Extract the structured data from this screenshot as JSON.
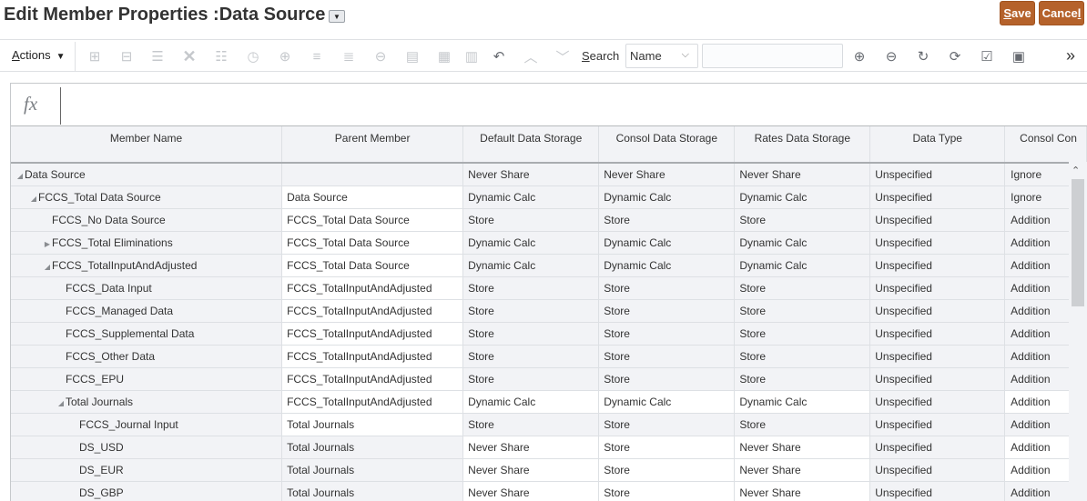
{
  "header": {
    "title": "Edit Member Properties :Data Source",
    "title_menu_icon": "dropdown-caret",
    "save_label": "Save",
    "save_mnemonic": "S",
    "cancel_label": "Cancel",
    "cancel_mnemonic": "l"
  },
  "toolbar": {
    "actions_label": "Actions",
    "actions_caret": "▼",
    "icons": [
      {
        "name": "add-child-icon",
        "enabled": false
      },
      {
        "name": "add-sibling-icon",
        "enabled": false
      },
      {
        "name": "edit-member-icon",
        "enabled": false
      },
      {
        "name": "delete-icon",
        "enabled": false
      },
      {
        "name": "expand-tree-icon",
        "enabled": false
      },
      {
        "name": "history-icon",
        "enabled": false
      },
      {
        "name": "zoom-in-icon",
        "enabled": false
      },
      {
        "name": "move-up-icon",
        "enabled": false
      },
      {
        "name": "move-down-icon",
        "enabled": false
      },
      {
        "name": "zoom-out-icon",
        "enabled": false
      },
      {
        "name": "cut-icon",
        "enabled": false
      },
      {
        "name": "remove-icon",
        "enabled": false
      },
      {
        "name": "columns-icon",
        "enabled": false
      },
      {
        "name": "undo-icon",
        "enabled": true
      },
      {
        "name": "previous-icon",
        "enabled": false
      },
      {
        "name": "next-icon",
        "enabled": false
      }
    ],
    "search_label": "Search",
    "search_mnemonic": "S",
    "search_by": "Name",
    "search_value": "",
    "right_icons": [
      {
        "name": "zoom-in-ancestors-icon"
      },
      {
        "name": "zoom-out-descendants-icon"
      },
      {
        "name": "refresh-icon"
      },
      {
        "name": "sync-icon"
      },
      {
        "name": "validate-icon"
      },
      {
        "name": "review-icon"
      }
    ],
    "overflow_label": "»"
  },
  "formula_bar": {
    "fx_label": "fx",
    "value": ""
  },
  "grid": {
    "columns": [
      "Member Name",
      "Parent Member",
      "Default Data Storage",
      "Consol Data Storage",
      "Rates Data Storage",
      "Data Type",
      "Consol Con"
    ],
    "rows": [
      {
        "name": "Data Source",
        "level": 0,
        "toggle": "expanded",
        "parent": "",
        "default_storage": "Never Share",
        "consol_storage": "Never Share",
        "rates_storage": "Never Share",
        "data_type": "Unspecified",
        "consol_op": "Ignore"
      },
      {
        "name": "FCCS_Total Data Source",
        "level": 1,
        "toggle": "expanded",
        "parent": "Data Source",
        "default_storage": "Dynamic Calc",
        "consol_storage": "Dynamic Calc",
        "rates_storage": "Dynamic Calc",
        "data_type": "Unspecified",
        "consol_op": "Ignore"
      },
      {
        "name": "FCCS_No Data Source",
        "level": 2,
        "toggle": "none",
        "parent": "FCCS_Total Data Source",
        "default_storage": "Store",
        "consol_storage": "Store",
        "rates_storage": "Store",
        "data_type": "Unspecified",
        "consol_op": "Addition"
      },
      {
        "name": "FCCS_Total Eliminations",
        "level": 2,
        "toggle": "collapsed",
        "parent": "FCCS_Total Data Source",
        "default_storage": "Dynamic Calc",
        "consol_storage": "Dynamic Calc",
        "rates_storage": "Dynamic Calc",
        "data_type": "Unspecified",
        "consol_op": "Addition"
      },
      {
        "name": "FCCS_TotalInputAndAdjusted",
        "level": 2,
        "toggle": "expanded",
        "parent": "FCCS_Total Data Source",
        "default_storage": "Dynamic Calc",
        "consol_storage": "Dynamic Calc",
        "rates_storage": "Dynamic Calc",
        "data_type": "Unspecified",
        "consol_op": "Addition"
      },
      {
        "name": "FCCS_Data Input",
        "level": 3,
        "toggle": "none",
        "parent": "FCCS_TotalInputAndAdjusted",
        "default_storage": "Store",
        "consol_storage": "Store",
        "rates_storage": "Store",
        "data_type": "Unspecified",
        "consol_op": "Addition"
      },
      {
        "name": "FCCS_Managed Data",
        "level": 3,
        "toggle": "none",
        "parent": "FCCS_TotalInputAndAdjusted",
        "default_storage": "Store",
        "consol_storage": "Store",
        "rates_storage": "Store",
        "data_type": "Unspecified",
        "consol_op": "Addition"
      },
      {
        "name": "FCCS_Supplemental Data",
        "level": 3,
        "toggle": "none",
        "parent": "FCCS_TotalInputAndAdjusted",
        "default_storage": "Store",
        "consol_storage": "Store",
        "rates_storage": "Store",
        "data_type": "Unspecified",
        "consol_op": "Addition"
      },
      {
        "name": "FCCS_Other Data",
        "level": 3,
        "toggle": "none",
        "parent": "FCCS_TotalInputAndAdjusted",
        "default_storage": "Store",
        "consol_storage": "Store",
        "rates_storage": "Store",
        "data_type": "Unspecified",
        "consol_op": "Addition"
      },
      {
        "name": "FCCS_EPU",
        "level": 3,
        "toggle": "none",
        "parent": "FCCS_TotalInputAndAdjusted",
        "default_storage": "Store",
        "consol_storage": "Store",
        "rates_storage": "Store",
        "data_type": "Unspecified",
        "consol_op": "Addition"
      },
      {
        "name": "Total Journals",
        "level": 3,
        "toggle": "expanded",
        "parent": "FCCS_TotalInputAndAdjusted",
        "default_storage": "Dynamic Calc",
        "consol_storage": "Dynamic Calc",
        "rates_storage": "Dynamic Calc",
        "data_type": "Unspecified",
        "consol_op": "Addition"
      },
      {
        "name": "FCCS_Journal Input",
        "level": 4,
        "toggle": "none",
        "parent": "Total Journals",
        "default_storage": "Store",
        "consol_storage": "Store",
        "rates_storage": "Store",
        "data_type": "Unspecified",
        "consol_op": "Addition"
      },
      {
        "name": "DS_USD",
        "level": 4,
        "toggle": "none",
        "parent": "Total Journals",
        "default_storage": "Never Share",
        "consol_storage": "Store",
        "rates_storage": "Never Share",
        "data_type": "Unspecified",
        "consol_op": "Addition"
      },
      {
        "name": "DS_EUR",
        "level": 4,
        "toggle": "none",
        "parent": "Total Journals",
        "default_storage": "Never Share",
        "consol_storage": "Store",
        "rates_storage": "Never Share",
        "data_type": "Unspecified",
        "consol_op": "Addition"
      },
      {
        "name": "DS_GBP",
        "level": 4,
        "toggle": "none",
        "parent": "Total Journals",
        "default_storage": "Never Share",
        "consol_storage": "Store",
        "rates_storage": "Never Share",
        "data_type": "Unspecified",
        "consol_op": "Addition"
      }
    ]
  },
  "colors": {
    "button_bg": "#b5622b",
    "header_bg": "#f2f3f6",
    "editable_cell_bg": "#ffffff"
  }
}
